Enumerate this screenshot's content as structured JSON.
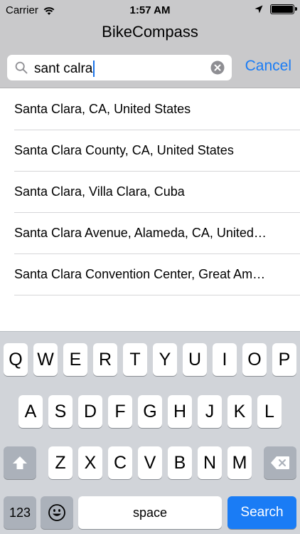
{
  "status_bar": {
    "carrier": "Carrier",
    "time": "1:57 AM",
    "icons": [
      "wifi-icon",
      "location-arrow-icon",
      "battery-icon"
    ]
  },
  "nav": {
    "title": "BikeCompass"
  },
  "search": {
    "value": "sant calra",
    "cancel_label": "Cancel",
    "icons": [
      "search-icon",
      "clear-icon"
    ]
  },
  "results": [
    {
      "label": "Santa Clara, CA, United States"
    },
    {
      "label": "Santa Clara County, CA, United States"
    },
    {
      "label": "Santa Clara, Villa Clara, Cuba"
    },
    {
      "label": "Santa Clara Avenue, Alameda, CA, United…"
    },
    {
      "label": "Santa Clara Convention Center, Great Am…"
    }
  ],
  "keyboard": {
    "row1": [
      "Q",
      "W",
      "E",
      "R",
      "T",
      "Y",
      "U",
      "I",
      "O",
      "P"
    ],
    "row2": [
      "A",
      "S",
      "D",
      "F",
      "G",
      "H",
      "J",
      "K",
      "L"
    ],
    "row3": [
      "Z",
      "X",
      "C",
      "V",
      "B",
      "N",
      "M"
    ],
    "numbers_label": "123",
    "space_label": "space",
    "search_label": "Search",
    "icons": [
      "shift-icon",
      "backspace-icon",
      "emoji-icon"
    ]
  },
  "colors": {
    "accent": "#1a7cf5",
    "bar_background": "#c9c9cb",
    "keyboard_background": "#d1d4d9"
  }
}
